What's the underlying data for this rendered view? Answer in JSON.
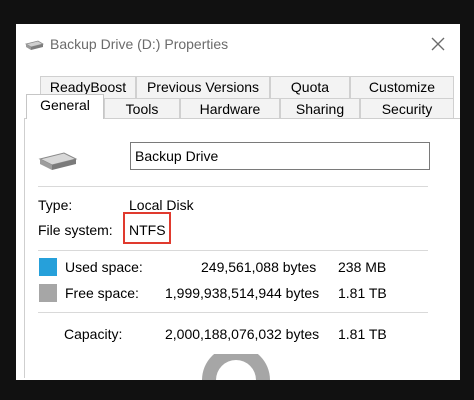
{
  "window": {
    "title": "Backup Drive (D:) Properties",
    "close_icon": "close-icon"
  },
  "tabs": {
    "row1": [
      "ReadyBoost",
      "Previous Versions",
      "Quota",
      "Customize"
    ],
    "row2": [
      "General",
      "Tools",
      "Hardware",
      "Sharing",
      "Security"
    ],
    "active": "General"
  },
  "general": {
    "drive_name": "Backup Drive",
    "type_label": "Type:",
    "type_value": "Local Disk",
    "fs_label": "File system:",
    "fs_value": "NTFS",
    "used": {
      "label": "Used space:",
      "bytes": "249,561,088 bytes",
      "size": "238 MB",
      "color": "#26a0da"
    },
    "free": {
      "label": "Free space:",
      "bytes": "1,999,938,514,944 bytes",
      "size": "1.81 TB",
      "color": "#a6a6a6"
    },
    "capacity": {
      "label": "Capacity:",
      "bytes": "2,000,188,076,032 bytes",
      "size": "1.81 TB"
    }
  },
  "colors": {
    "highlight_border": "#e03a2e",
    "accent": "#26a0da"
  }
}
